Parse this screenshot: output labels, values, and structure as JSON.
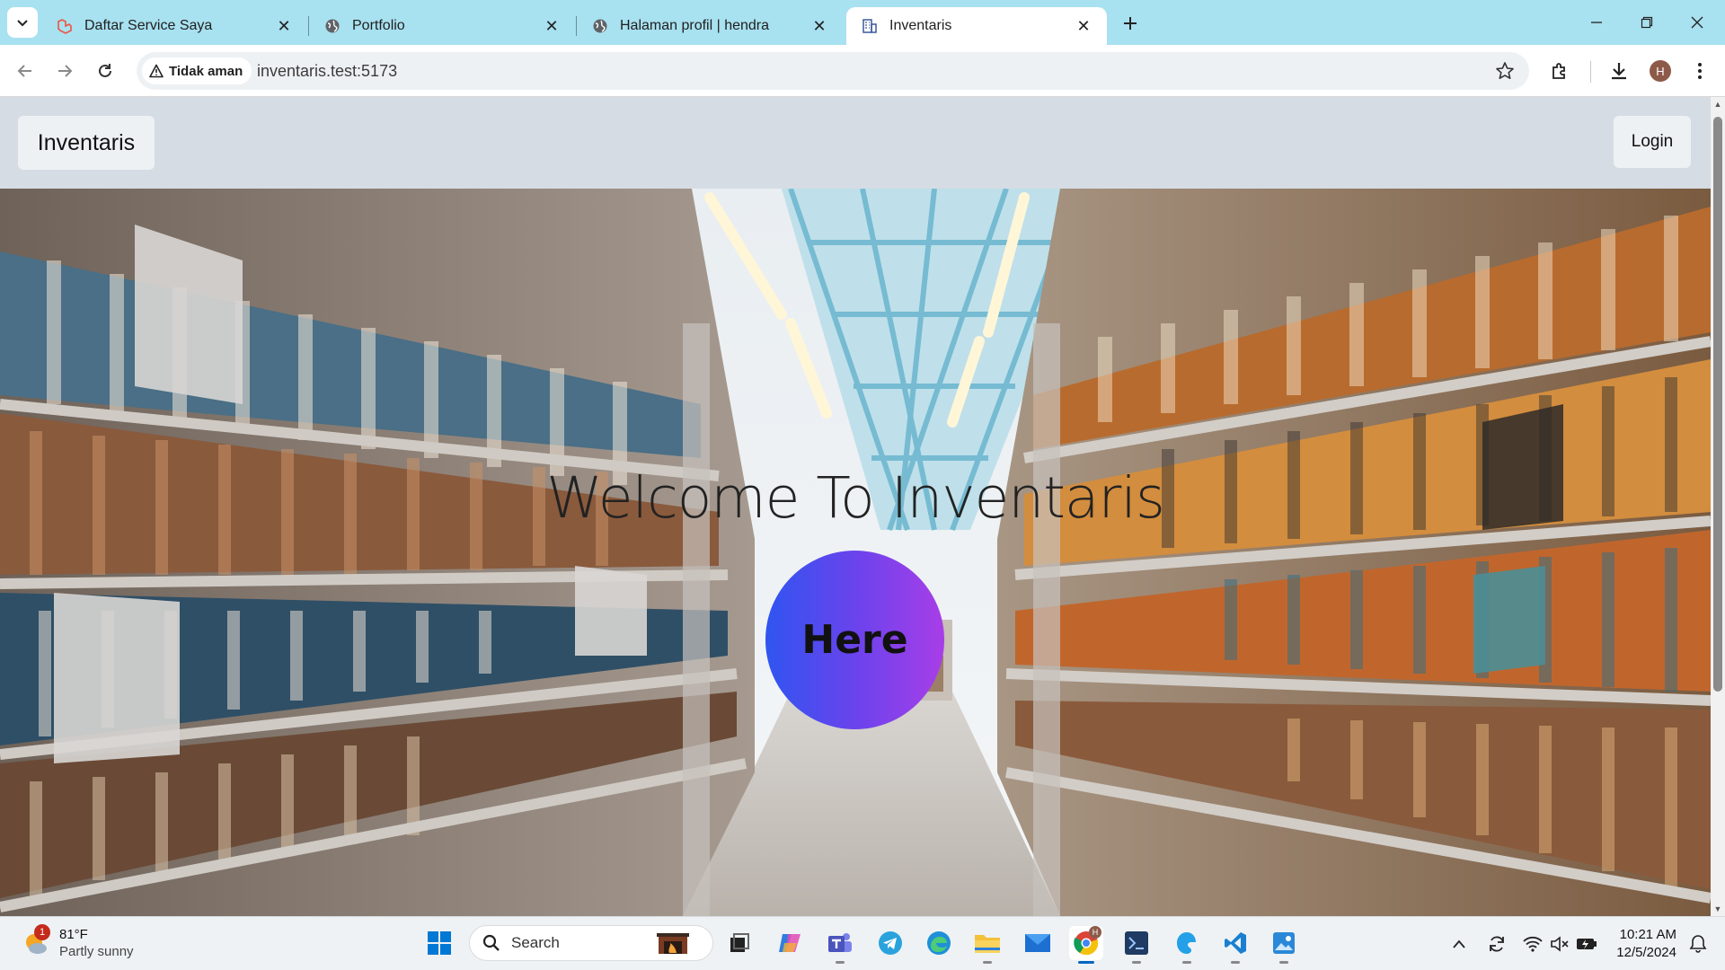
{
  "browser": {
    "tabs": [
      {
        "title": "Daftar Service Saya",
        "icon": "laravel-icon",
        "active": false
      },
      {
        "title": "Portfolio",
        "icon": "globe-icon",
        "active": false
      },
      {
        "title": "Halaman profil | hendra",
        "icon": "globe-icon",
        "active": false
      },
      {
        "title": "Inventaris",
        "icon": "building-icon",
        "active": true
      }
    ],
    "security_chip": "Tidak aman",
    "url": "inventaris.test:5173",
    "profile_initial": "H"
  },
  "page": {
    "brand": "Inventaris",
    "login_label": "Login",
    "hero_title": "Welcome To Inventaris",
    "cta_label": "Here",
    "cta_gradient": [
      "#2f55f0",
      "#a83ee8"
    ]
  },
  "taskbar": {
    "weather_temp": "81°F",
    "weather_desc": "Partly sunny",
    "weather_badge": "1",
    "search_placeholder": "Search",
    "time": "10:21 AM",
    "date": "12/5/2024",
    "chrome_badge": "H"
  },
  "colors": {
    "tabbar_bg": "#a8e1f0",
    "page_bg": "#d5dce4",
    "taskbar_bg": "#eef2f4",
    "accent": "#0067c0"
  }
}
